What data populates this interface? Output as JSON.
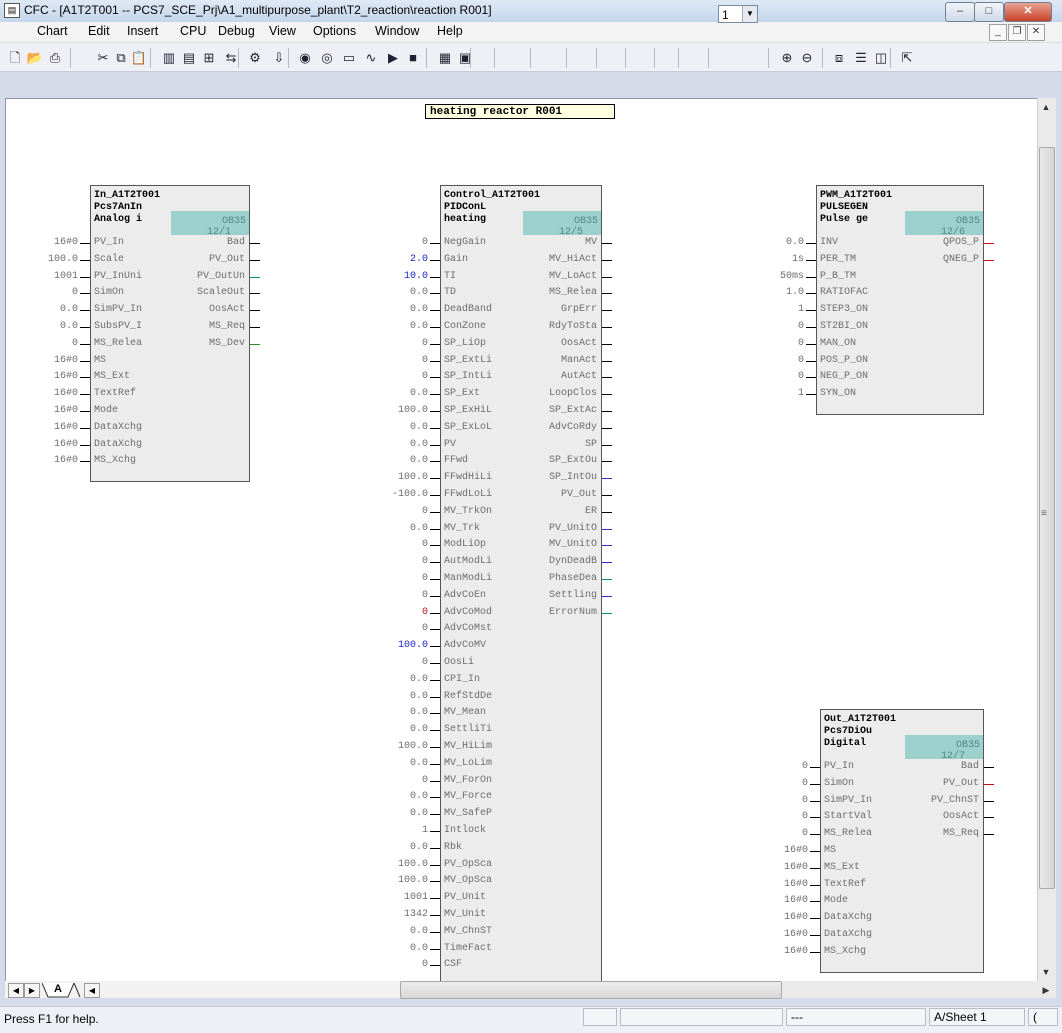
{
  "window": {
    "title": "CFC - [A1T2T001 -- PCS7_SCE_Prj\\A1_multipurpose_plant\\T2_reaction\\reaction R001]",
    "min": "–",
    "max": "□",
    "close": "✕"
  },
  "menu": {
    "items": [
      "Chart",
      "Edit",
      "Insert",
      "CPU",
      "Debug",
      "View",
      "Options",
      "Window",
      "Help"
    ],
    "mdi_min": "_",
    "mdi_restore": "❐",
    "mdi_close": "✕"
  },
  "toolbar": {
    "zoom_value": "1",
    "icons": [
      "new-icon",
      "open-icon",
      "print-icon",
      "cut-icon",
      "copy-icon",
      "paste-icon",
      "block-types-icon",
      "catalog-icon",
      "overview-icon",
      "connect-icon",
      "compile-icon",
      "download-icon",
      "test-mode-icon",
      "watch-icon",
      "monitor-icon",
      "trend-icon",
      "run-icon",
      "stop-icon",
      "grid-icon",
      "sheet-view-icon",
      "zoom-in-icon",
      "zoom-out-icon",
      "overview-window-icon",
      "split-icon",
      "layout-icon",
      "help-pointer-icon"
    ]
  },
  "chart_title": "heating reactor R001",
  "blocks": {
    "in": {
      "lines": [
        "In_A1T2T001",
        "Pcs7AnIn",
        "Analog i"
      ],
      "ob": "OB35",
      "seq": "12/1",
      "inputs": [
        {
          "v": "16#0",
          "n": "PV_In",
          "c": "g"
        },
        {
          "v": "100.0",
          "n": "Scale",
          "c": "g"
        },
        {
          "v": "1001",
          "n": "PV_InUni",
          "c": "g"
        },
        {
          "v": "0",
          "n": "SimOn",
          "c": "g"
        },
        {
          "v": "0.0",
          "n": "SimPV_In",
          "c": "g"
        },
        {
          "v": "0.0",
          "n": "SubsPV_I",
          "c": "g"
        },
        {
          "v": "0",
          "n": "MS_Relea",
          "c": "g"
        },
        {
          "v": "16#0",
          "n": "MS",
          "c": "g"
        },
        {
          "v": "16#0",
          "n": "MS_Ext",
          "c": "g"
        },
        {
          "v": "16#0",
          "n": "TextRef",
          "c": "g"
        },
        {
          "v": "16#0",
          "n": "Mode",
          "c": "g"
        },
        {
          "v": "16#0",
          "n": "DataXchg",
          "c": "g"
        },
        {
          "v": "16#0",
          "n": "DataXchg",
          "c": "g"
        },
        {
          "v": "16#0",
          "n": "MS_Xchg",
          "c": "g"
        }
      ],
      "outputs": [
        {
          "n": "Bad",
          "c": "#000000"
        },
        {
          "n": "PV_Out",
          "c": "#000000"
        },
        {
          "n": "PV_OutUn",
          "c": "#0d8a8a"
        },
        {
          "n": "ScaleOut",
          "c": "#000000"
        },
        {
          "n": "OosAct",
          "c": "#000000"
        },
        {
          "n": "MS_Req",
          "c": "#000000"
        },
        {
          "n": "MS_Dev",
          "c": "#2c8c2c"
        }
      ]
    },
    "control": {
      "lines": [
        "Control_A1T2T001",
        "PIDConL",
        "heating"
      ],
      "ob": "OB35",
      "seq": "12/5",
      "inputs": [
        {
          "v": "0",
          "n": "NegGain",
          "c": "g"
        },
        {
          "v": "2.0",
          "n": "Gain",
          "c": "b"
        },
        {
          "v": "10.0",
          "n": "TI",
          "c": "b"
        },
        {
          "v": "0.0",
          "n": "TD",
          "c": "g"
        },
        {
          "v": "0.0",
          "n": "DeadBand",
          "c": "g"
        },
        {
          "v": "0.0",
          "n": "ConZone",
          "c": "g"
        },
        {
          "v": "0",
          "n": "SP_LiOp",
          "c": "g"
        },
        {
          "v": "0",
          "n": "SP_ExtLi",
          "c": "g"
        },
        {
          "v": "0",
          "n": "SP_IntLi",
          "c": "g"
        },
        {
          "v": "0.0",
          "n": "SP_Ext",
          "c": "g"
        },
        {
          "v": "100.0",
          "n": "SP_ExHiL",
          "c": "g"
        },
        {
          "v": "0.0",
          "n": "SP_ExLoL",
          "c": "g"
        },
        {
          "v": "0.0",
          "n": "PV",
          "c": "g"
        },
        {
          "v": "0.0",
          "n": "FFwd",
          "c": "g"
        },
        {
          "v": "100.0",
          "n": "FFwdHiLi",
          "c": "g"
        },
        {
          "v": "-100.0",
          "n": "FFwdLoLi",
          "c": "g"
        },
        {
          "v": "0",
          "n": "MV_TrkOn",
          "c": "g"
        },
        {
          "v": "0.0",
          "n": "MV_Trk",
          "c": "g"
        },
        {
          "v": "0",
          "n": "ModLiOp",
          "c": "g"
        },
        {
          "v": "0",
          "n": "AutModLi",
          "c": "g"
        },
        {
          "v": "0",
          "n": "ManModLi",
          "c": "g"
        },
        {
          "v": "0",
          "n": "AdvCoEn",
          "c": "g"
        },
        {
          "v": "0",
          "n": "AdvCoMod",
          "c": "r"
        },
        {
          "v": "0",
          "n": "AdvCoMst",
          "c": "g"
        },
        {
          "v": "100.0",
          "n": "AdvCoMV",
          "c": "b"
        },
        {
          "v": "0",
          "n": "OosLi",
          "c": "g"
        },
        {
          "v": "0.0",
          "n": "CPI_In",
          "c": "g"
        },
        {
          "v": "0.0",
          "n": "RefStdDe",
          "c": "g"
        },
        {
          "v": "0.0",
          "n": "MV_Mean",
          "c": "g"
        },
        {
          "v": "0.0",
          "n": "SettliTi",
          "c": "g"
        },
        {
          "v": "100.0",
          "n": "MV_HiLim",
          "c": "g"
        },
        {
          "v": "0.0",
          "n": "MV_LoLim",
          "c": "g"
        },
        {
          "v": "0",
          "n": "MV_ForOn",
          "c": "g"
        },
        {
          "v": "0.0",
          "n": "MV_Force",
          "c": "g"
        },
        {
          "v": "0.0",
          "n": "MV_SafeP",
          "c": "g"
        },
        {
          "v": "1",
          "n": "Intlock",
          "c": "g"
        },
        {
          "v": "0.0",
          "n": "Rbk",
          "c": "g"
        },
        {
          "v": "100.0",
          "n": "PV_OpSca",
          "c": "g"
        },
        {
          "v": "100.0",
          "n": "MV_OpSca",
          "c": "g"
        },
        {
          "v": "1001",
          "n": "PV_Unit",
          "c": "g"
        },
        {
          "v": "1342",
          "n": "MV_Unit",
          "c": "g"
        },
        {
          "v": "0.0",
          "n": "MV_ChnST",
          "c": "g"
        },
        {
          "v": "0.0",
          "n": "TimeFact",
          "c": "g"
        },
        {
          "v": "0",
          "n": "CSF",
          "c": "g"
        }
      ],
      "outputs": [
        {
          "n": "MV",
          "c": "#000000"
        },
        {
          "n": "MV_HiAct",
          "c": "#000000"
        },
        {
          "n": "MV_LoAct",
          "c": "#000000"
        },
        {
          "n": "MS_Relea",
          "c": "#000000"
        },
        {
          "n": "GrpErr",
          "c": "#000000"
        },
        {
          "n": "RdyToSta",
          "c": "#000000"
        },
        {
          "n": "OosAct",
          "c": "#000000"
        },
        {
          "n": "ManAct",
          "c": "#000000"
        },
        {
          "n": "AutAct",
          "c": "#000000"
        },
        {
          "n": "LoopClos",
          "c": "#000000"
        },
        {
          "n": "SP_ExtAc",
          "c": "#000000"
        },
        {
          "n": "AdvCoRdy",
          "c": "#000000"
        },
        {
          "n": "SP",
          "c": "#000000"
        },
        {
          "n": "SP_ExtOu",
          "c": "#000000"
        },
        {
          "n": "SP_IntOu",
          "c": "#2a35c0"
        },
        {
          "n": "PV_Out",
          "c": "#000000"
        },
        {
          "n": "ER",
          "c": "#000000"
        },
        {
          "n": "PV_UnitO",
          "c": "#2a35c0"
        },
        {
          "n": "MV_UnitO",
          "c": "#2a35c0"
        },
        {
          "n": "DynDeadB",
          "c": "#2a35c0"
        },
        {
          "n": "PhaseDea",
          "c": "#0d8a8a"
        },
        {
          "n": "Settling",
          "c": "#2a35c0"
        },
        {
          "n": "ErrorNum",
          "c": "#0d8a8a"
        }
      ]
    },
    "pwm": {
      "lines": [
        "PWM_A1T2T001",
        "PULSEGEN",
        "Pulse ge"
      ],
      "ob": "OB35",
      "seq": "12/6",
      "inputs": [
        {
          "v": "0.0",
          "n": "INV",
          "c": "g"
        },
        {
          "v": "1s",
          "n": "PER_TM",
          "c": "g"
        },
        {
          "v": "50ms",
          "n": "P_B_TM",
          "c": "g"
        },
        {
          "v": "1.0",
          "n": "RATIOFAC",
          "c": "g"
        },
        {
          "v": "1",
          "n": "STEP3_ON",
          "c": "g"
        },
        {
          "v": "0",
          "n": "ST2BI_ON",
          "c": "g"
        },
        {
          "v": "0",
          "n": "MAN_ON",
          "c": "g"
        },
        {
          "v": "0",
          "n": "POS_P_ON",
          "c": "g"
        },
        {
          "v": "0",
          "n": "NEG_P_ON",
          "c": "g"
        },
        {
          "v": "1",
          "n": "SYN_ON",
          "c": "g"
        }
      ],
      "outputs": [
        {
          "n": "QPOS_P",
          "c": "#c01010"
        },
        {
          "n": "QNEG_P",
          "c": "#c01010"
        }
      ]
    },
    "out": {
      "lines": [
        "Out_A1T2T001",
        "Pcs7DiOu",
        "Digital"
      ],
      "ob": "OB35",
      "seq": "12/7",
      "inputs": [
        {
          "v": "0",
          "n": "PV_In",
          "c": "g"
        },
        {
          "v": "0",
          "n": "SimOn",
          "c": "g"
        },
        {
          "v": "0",
          "n": "SimPV_In",
          "c": "g"
        },
        {
          "v": "0",
          "n": "StartVal",
          "c": "g"
        },
        {
          "v": "0",
          "n": "MS_Relea",
          "c": "g"
        },
        {
          "v": "16#0",
          "n": "MS",
          "c": "g"
        },
        {
          "v": "16#0",
          "n": "MS_Ext",
          "c": "g"
        },
        {
          "v": "16#0",
          "n": "TextRef",
          "c": "g"
        },
        {
          "v": "16#0",
          "n": "Mode",
          "c": "g"
        },
        {
          "v": "16#0",
          "n": "DataXchg",
          "c": "g"
        },
        {
          "v": "16#0",
          "n": "DataXchg",
          "c": "g"
        },
        {
          "v": "16#0",
          "n": "MS_Xchg",
          "c": "g"
        }
      ],
      "outputs": [
        {
          "n": "Bad",
          "c": "#000000"
        },
        {
          "n": "PV_Out",
          "c": "#c01010"
        },
        {
          "n": "PV_ChnST",
          "c": "#000000"
        },
        {
          "n": "OosAct",
          "c": "#000000"
        },
        {
          "n": "MS_Req",
          "c": "#000000"
        }
      ]
    }
  },
  "sheet_tab": "A",
  "status": {
    "help": "Press F1 for help.",
    "panel_mode": "---",
    "sheet": "A/Sheet 1",
    "last": "("
  }
}
